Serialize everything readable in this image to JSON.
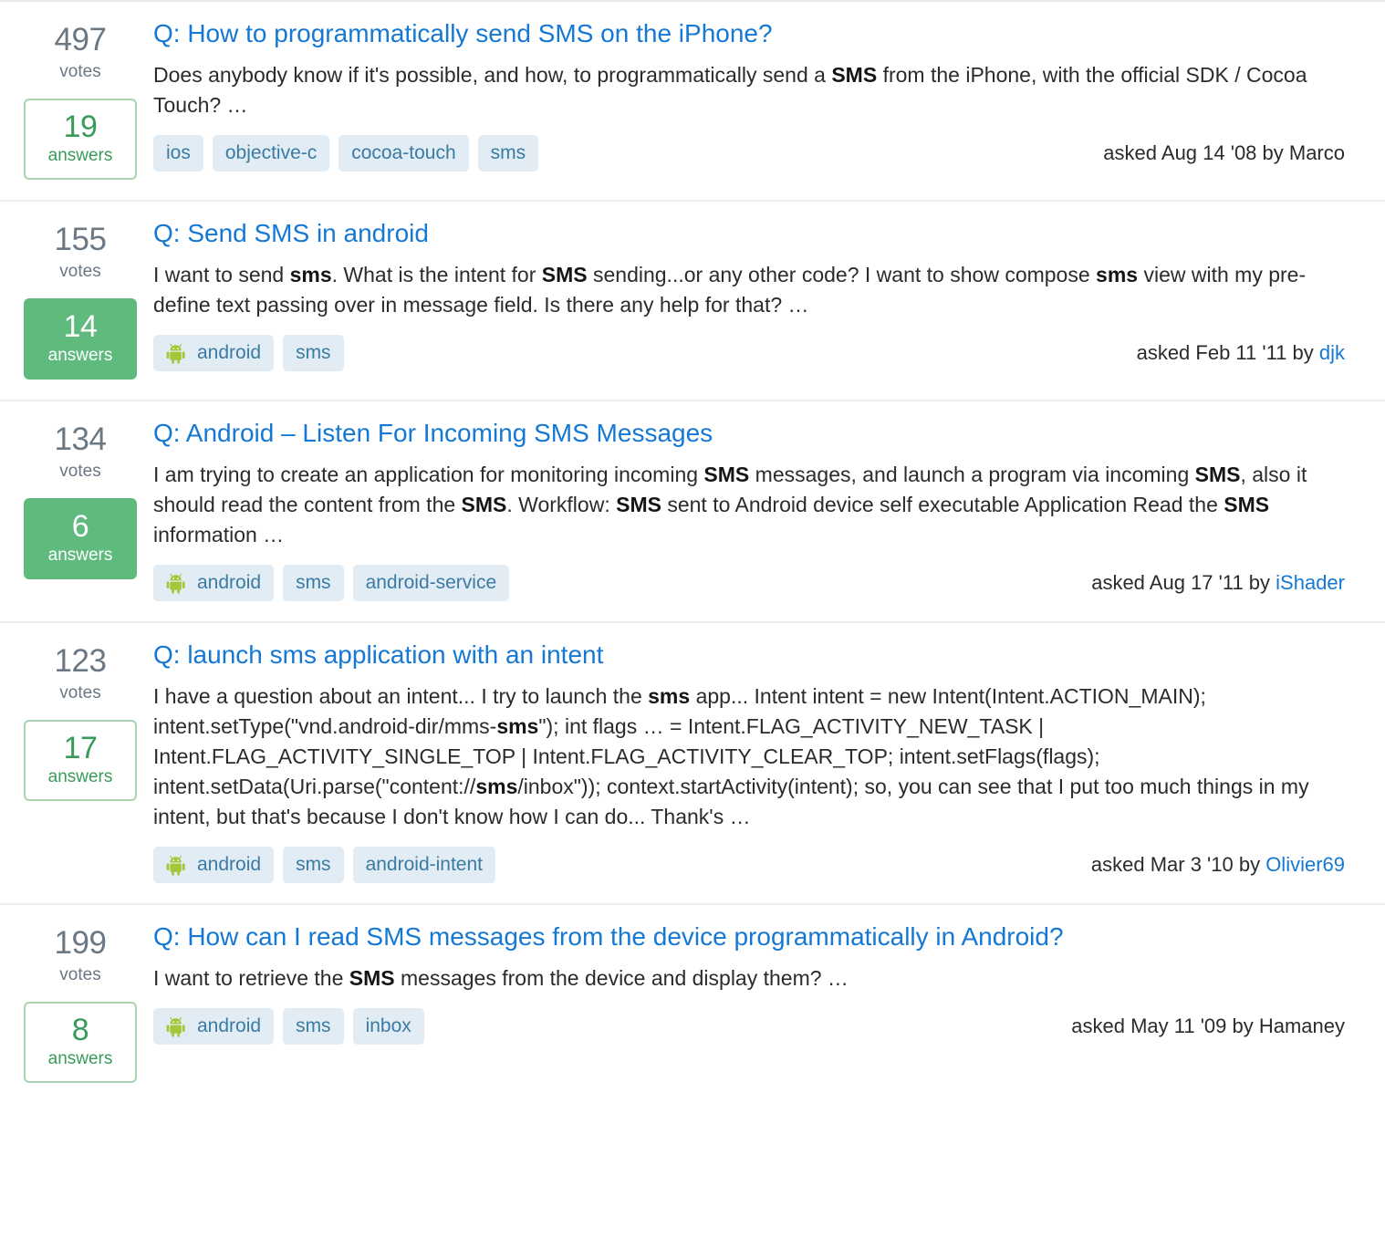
{
  "colors": {
    "title_link": "#1478d4",
    "tag_bg": "#e1ecf4",
    "tag_text": "#3b7ba3",
    "answers_filled_bg": "#5fba7d",
    "answers_outline_border": "#a9d3ae",
    "answers_outline_text": "#3a9a5a",
    "votes_text": "#6b7884",
    "body_text": "#2b2b2b",
    "row_divider": "#eceeef"
  },
  "labels": {
    "votes": "votes",
    "answers": "answers"
  },
  "results": [
    {
      "votes": "497",
      "answers": "19",
      "answers_style": "outlined",
      "title": "Q: How to programmatically send SMS on the iPhone?",
      "excerpt_parts": [
        {
          "text": "Does anybody know if it's possible, and how, to programmatically send a ",
          "bold": false
        },
        {
          "text": "SMS",
          "bold": true
        },
        {
          "text": " from the iPhone, with the official SDK / Cocoa Touch? …",
          "bold": false
        }
      ],
      "tags": [
        {
          "label": "ios",
          "icon": ""
        },
        {
          "label": "objective-c",
          "icon": ""
        },
        {
          "label": "cocoa-touch",
          "icon": ""
        },
        {
          "label": "sms",
          "icon": ""
        }
      ],
      "asked_prefix": "asked Aug 14 '08 by ",
      "author": "Marco",
      "author_is_link": false
    },
    {
      "votes": "155",
      "answers": "14",
      "answers_style": "filled",
      "title": "Q: Send SMS in android",
      "excerpt_parts": [
        {
          "text": "I want to send ",
          "bold": false
        },
        {
          "text": "sms",
          "bold": true
        },
        {
          "text": ". What is the intent for ",
          "bold": false
        },
        {
          "text": "SMS",
          "bold": true
        },
        {
          "text": " sending...or any other code? I want to show compose ",
          "bold": false
        },
        {
          "text": "sms",
          "bold": true
        },
        {
          "text": " view with my pre-define text passing over in message field. Is there any help for that? …",
          "bold": false
        }
      ],
      "tags": [
        {
          "label": "android",
          "icon": "android-icon"
        },
        {
          "label": "sms",
          "icon": ""
        }
      ],
      "asked_prefix": "asked Feb 11 '11 by ",
      "author": "djk",
      "author_is_link": true
    },
    {
      "votes": "134",
      "answers": "6",
      "answers_style": "filled",
      "title": "Q: Android – Listen For Incoming SMS Messages",
      "excerpt_parts": [
        {
          "text": "I am trying to create an application for monitoring incoming ",
          "bold": false
        },
        {
          "text": "SMS",
          "bold": true
        },
        {
          "text": " messages, and launch a program via incoming ",
          "bold": false
        },
        {
          "text": "SMS",
          "bold": true
        },
        {
          "text": ", also it should read the content from the ",
          "bold": false
        },
        {
          "text": "SMS",
          "bold": true
        },
        {
          "text": ". Workflow: ",
          "bold": false
        },
        {
          "text": "SMS",
          "bold": true
        },
        {
          "text": " sent to Android device self executable Application Read the ",
          "bold": false
        },
        {
          "text": "SMS",
          "bold": true
        },
        {
          "text": " information …",
          "bold": false
        }
      ],
      "tags": [
        {
          "label": "android",
          "icon": "android-icon"
        },
        {
          "label": "sms",
          "icon": ""
        },
        {
          "label": "android-service",
          "icon": ""
        }
      ],
      "asked_prefix": "asked Aug 17 '11 by ",
      "author": "iShader",
      "author_is_link": true
    },
    {
      "votes": "123",
      "answers": "17",
      "answers_style": "outlined",
      "title": "Q: launch sms application with an intent",
      "excerpt_parts": [
        {
          "text": "I have a question about an intent... I try to launch the ",
          "bold": false
        },
        {
          "text": "sms",
          "bold": true
        },
        {
          "text": " app... Intent intent = new Intent(Intent.ACTION_MAIN); intent.setType(\"vnd.android-dir/mms-",
          "bold": false
        },
        {
          "text": "sms",
          "bold": true
        },
        {
          "text": "\"); int flags … = Intent.FLAG_ACTIVITY_NEW_TASK | Intent.FLAG_ACTIVITY_SINGLE_TOP | Intent.FLAG_ACTIVITY_CLEAR_TOP; intent.setFlags(flags); intent.setData(Uri.parse(\"content://",
          "bold": false
        },
        {
          "text": "sms",
          "bold": true
        },
        {
          "text": "/inbox\")); context.startActivity(intent); so, you can see that I put too much things in my intent, but that's because I don't know how I can do... Thank's …",
          "bold": false
        }
      ],
      "tags": [
        {
          "label": "android",
          "icon": "android-icon"
        },
        {
          "label": "sms",
          "icon": ""
        },
        {
          "label": "android-intent",
          "icon": ""
        }
      ],
      "asked_prefix": "asked Mar 3 '10 by ",
      "author": "Olivier69",
      "author_is_link": true
    },
    {
      "votes": "199",
      "answers": "8",
      "answers_style": "outlined",
      "title": "Q: How can I read SMS messages from the device programmatically in Android?",
      "excerpt_parts": [
        {
          "text": "I want to retrieve the ",
          "bold": false
        },
        {
          "text": "SMS",
          "bold": true
        },
        {
          "text": " messages from the device and display them? …",
          "bold": false
        }
      ],
      "tags": [
        {
          "label": "android",
          "icon": "android-icon"
        },
        {
          "label": "sms",
          "icon": ""
        },
        {
          "label": "inbox",
          "icon": ""
        }
      ],
      "asked_prefix": "asked May 11 '09 by ",
      "author": "Hamaney",
      "author_is_link": false
    }
  ]
}
